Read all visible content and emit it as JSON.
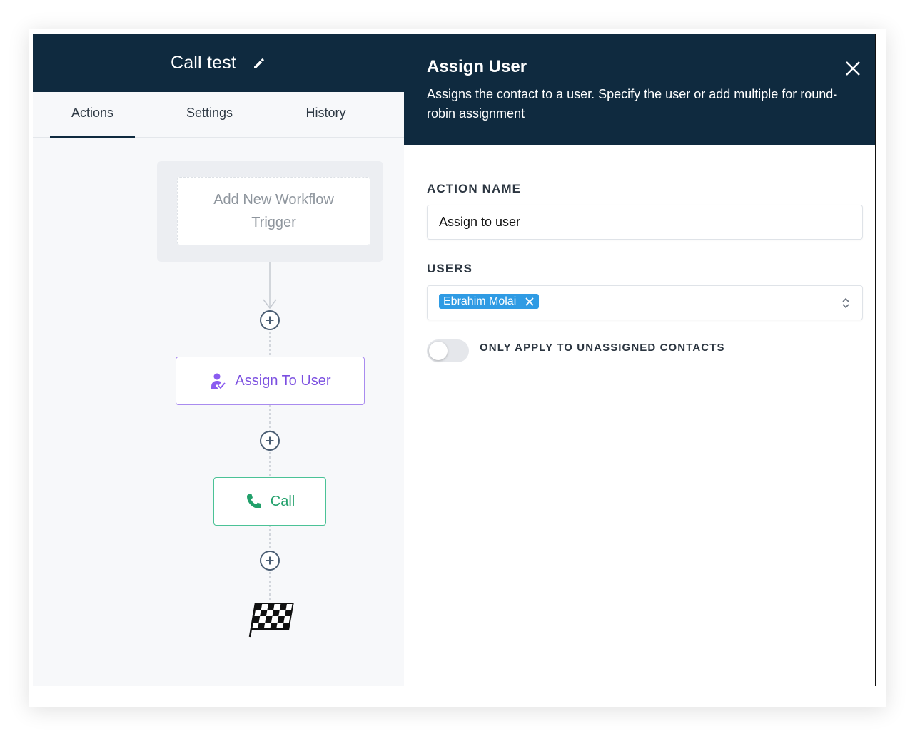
{
  "workflow": {
    "title": "Call test",
    "edit_icon": "pencil-icon"
  },
  "tabs": [
    {
      "label": "Actions",
      "active": true
    },
    {
      "label": "Settings",
      "active": false
    },
    {
      "label": "History",
      "active": false
    }
  ],
  "canvas": {
    "trigger_label": "Add New Workflow\nTrigger",
    "nodes": [
      {
        "label": "Assign To User",
        "icon": "user-check-icon",
        "color": "#7b4fe0"
      },
      {
        "label": "Call",
        "icon": "phone-icon",
        "color": "#22a06b"
      }
    ],
    "add_icon": "plus-circle-icon",
    "end_icon": "checkered-flag-icon"
  },
  "panel": {
    "title": "Assign User",
    "description": "Assigns the contact to a user. Specify the user or add multiple for round-robin assignment",
    "close_icon": "close-icon",
    "action_name_label": "ACTION NAME",
    "action_name_value": "Assign to user",
    "users_label": "USERS",
    "selected_users": [
      "Ebrahim Molai"
    ],
    "toggle_label": "ONLY APPLY TO UNASSIGNED CONTACTS",
    "toggle_on": false
  },
  "colors": {
    "header_bg": "#0f2a3f",
    "chip_bg": "#2f9be4",
    "assign_accent": "#7b4fe0",
    "call_accent": "#22a06b"
  }
}
